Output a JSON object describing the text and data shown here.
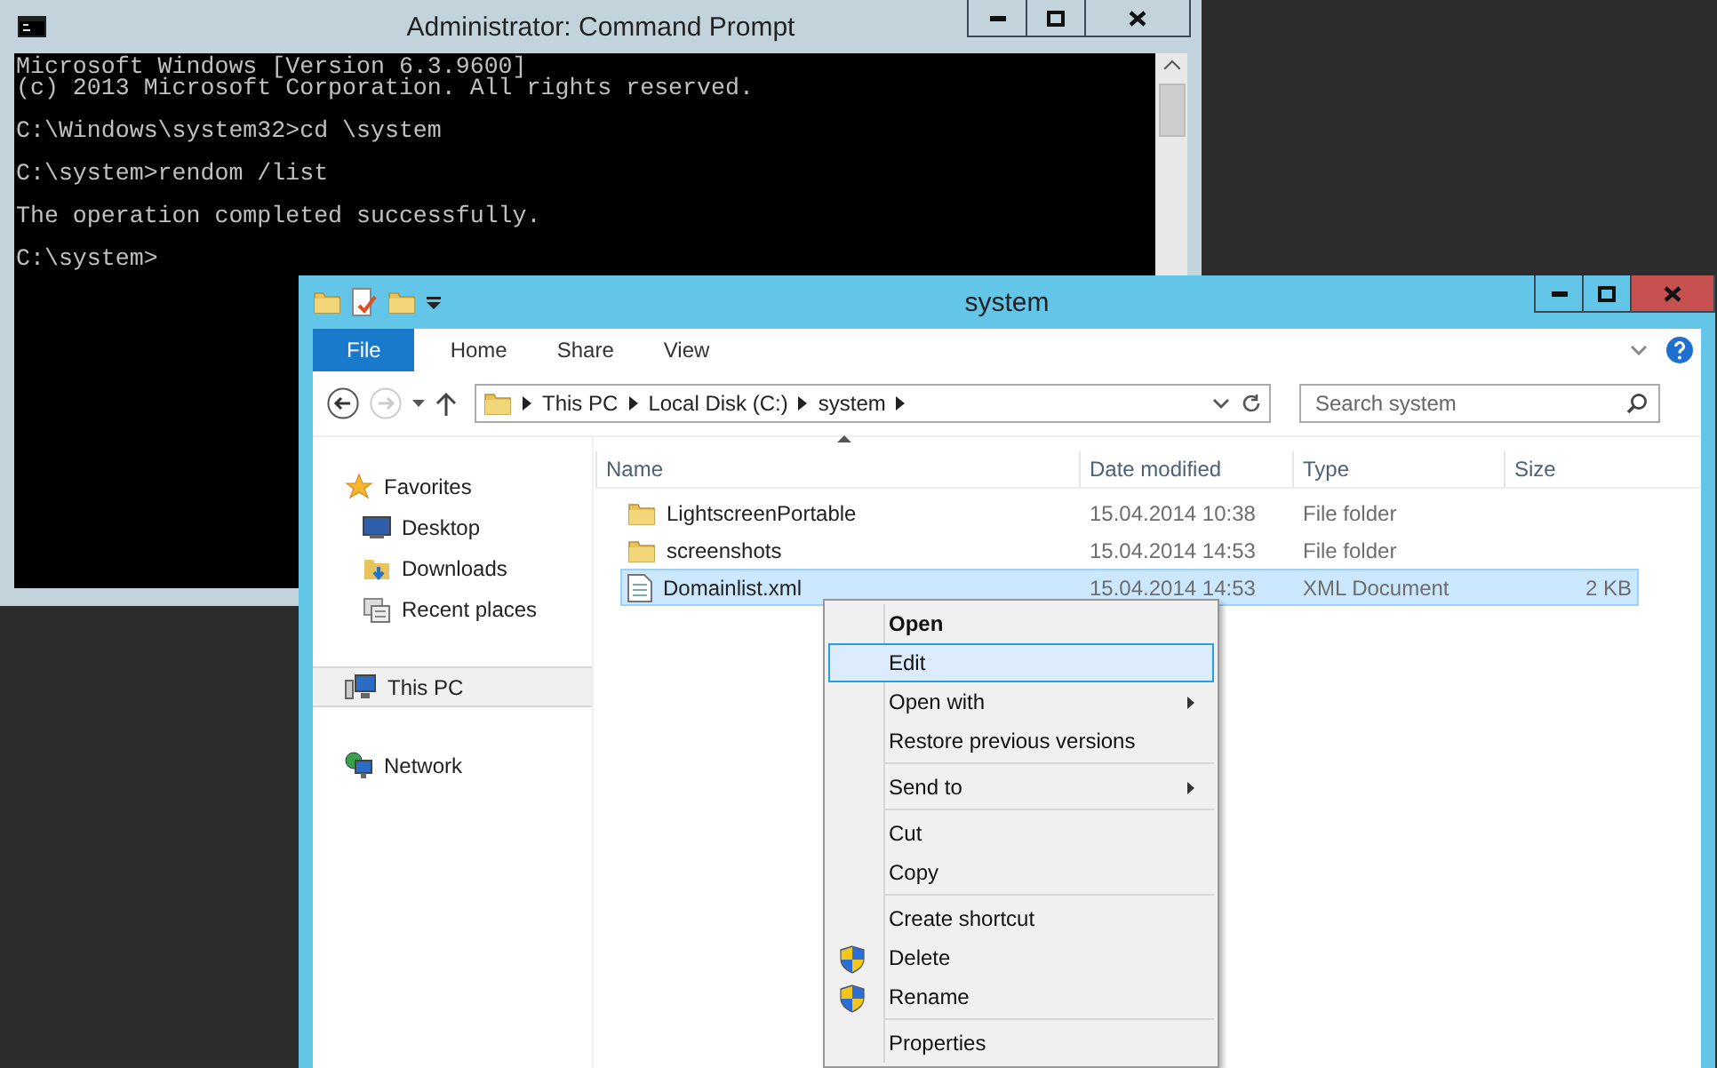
{
  "console_window": {
    "title": "Administrator: Command Prompt",
    "blocks": [
      [
        "Microsoft Windows [Version 6.3.9600]",
        "(c) 2013 Microsoft Corporation. All rights reserved."
      ],
      [
        "C:\\Windows\\system32>cd \\system"
      ],
      [
        "C:\\system>rendom /list"
      ],
      [
        "The operation completed successfully."
      ],
      [
        "C:\\system>"
      ]
    ]
  },
  "explorer_window": {
    "title": "system",
    "ribbon_tabs": [
      {
        "label": "File",
        "kind": "file"
      },
      {
        "label": "Home",
        "kind": "tab"
      },
      {
        "label": "Share",
        "kind": "tab"
      },
      {
        "label": "View",
        "kind": "tab"
      }
    ],
    "breadcrumbs": [
      "This PC",
      "Local Disk (C:)",
      "system"
    ],
    "search": {
      "placeholder": "Search system"
    },
    "nav": [
      {
        "label": "Favorites",
        "kind": "star",
        "selected": false,
        "children": [
          {
            "label": "Desktop",
            "kind": "desktop",
            "selected": false
          },
          {
            "label": "Downloads",
            "kind": "downloads",
            "selected": false
          },
          {
            "label": "Recent places",
            "kind": "recent",
            "selected": false
          }
        ]
      },
      {
        "label": "This PC",
        "kind": "pc",
        "selected": true
      },
      {
        "label": "Network",
        "kind": "network",
        "selected": false
      }
    ],
    "columns": [
      "Name",
      "Date modified",
      "Type",
      "Size"
    ],
    "rows": [
      {
        "name": "LightscreenPortable",
        "kind": "folder",
        "date": "15.04.2014 10:38",
        "type": "File folder",
        "selected": false
      },
      {
        "name": "screenshots",
        "kind": "folder",
        "date": "15.04.2014 14:53",
        "type": "File folder",
        "selected": false
      },
      {
        "name": "Domainlist.xml",
        "kind": "xml",
        "date": "15.04.2014 14:53",
        "type": "XML Document",
        "size": "2 KB",
        "selected": true
      }
    ]
  },
  "context_menu": {
    "groups": [
      [
        {
          "label": "Open",
          "default": true,
          "selected": false
        },
        {
          "label": "Edit",
          "selected": true
        },
        {
          "label": "Open with",
          "submenu": true,
          "selected": false
        },
        {
          "label": "Restore previous versions",
          "selected": false
        }
      ],
      [
        {
          "label": "Send to",
          "submenu": true,
          "selected": false
        }
      ],
      [
        {
          "label": "Cut",
          "selected": false
        },
        {
          "label": "Copy",
          "selected": false
        }
      ],
      [
        {
          "label": "Create shortcut",
          "selected": false
        },
        {
          "label": "Delete",
          "shield": true,
          "selected": false
        },
        {
          "label": "Rename",
          "shield": true,
          "selected": false
        }
      ],
      [
        {
          "label": "Properties",
          "selected": false
        }
      ]
    ]
  }
}
